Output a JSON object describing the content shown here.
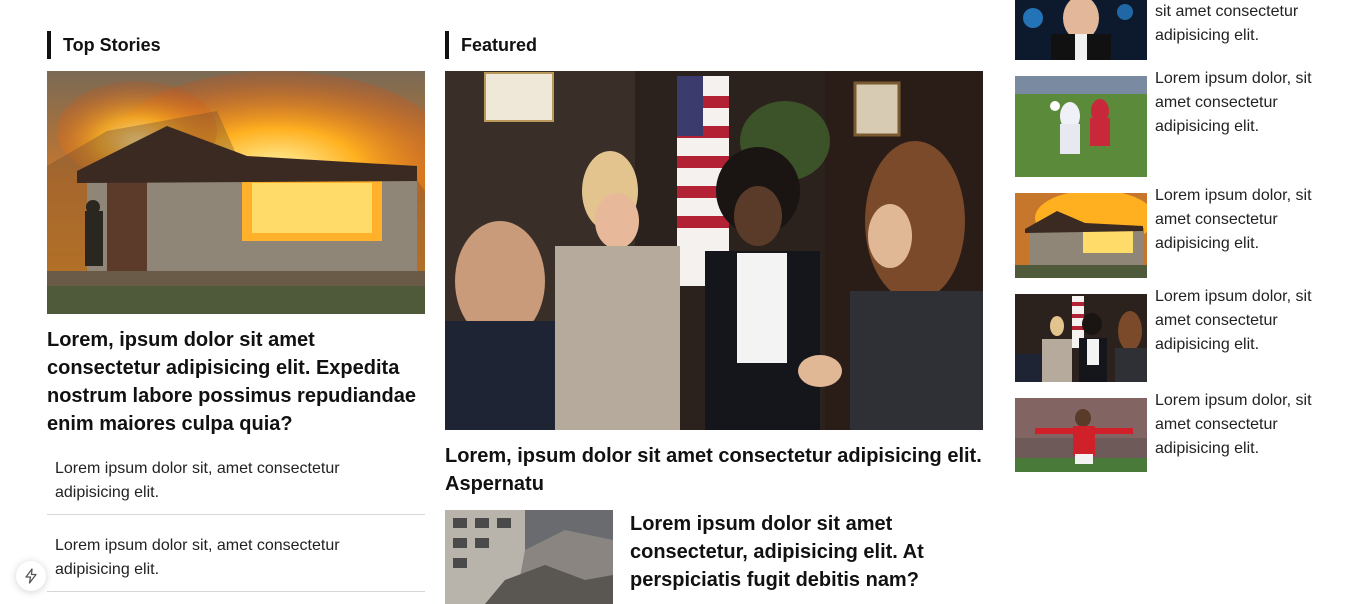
{
  "top_stories": {
    "title": "Top Stories",
    "lead_headline": "Lorem, ipsum dolor sit amet consectetur adipisicing elit. Expedita nostrum labore possimus repudiandae enim maiores culpa quia?",
    "items": [
      "Lorem ipsum dolor sit, amet consectetur adipisicing elit.",
      "Lorem ipsum dolor sit, amet consectetur adipisicing elit."
    ]
  },
  "featured": {
    "title": "Featured",
    "lead_headline": "Lorem, ipsum dolor sit amet consectetur adipisicing elit. Aspernatu",
    "secondary_headline": "Lorem ipsum dolor sit amet consectetur, adipisicing elit. At perspiciatis fugit debitis nam?"
  },
  "sidebar": {
    "items": [
      {
        "text": "sit amet consectetur adipisicing elit.",
        "image": "tech-portrait"
      },
      {
        "text": "Lorem ipsum dolor, sit amet consectetur adipisicing elit.",
        "image": "soccer-match"
      },
      {
        "text": "Lorem ipsum dolor, sit amet consectetur adipisicing elit.",
        "image": "house-fire"
      },
      {
        "text": "Lorem ipsum dolor, sit amet consectetur adipisicing elit.",
        "image": "meeting"
      },
      {
        "text": "Lorem ipsum dolor, sit amet consectetur adipisicing elit.",
        "image": "soccer-celebration"
      }
    ]
  },
  "icons": {
    "fab": "lightning-icon"
  }
}
